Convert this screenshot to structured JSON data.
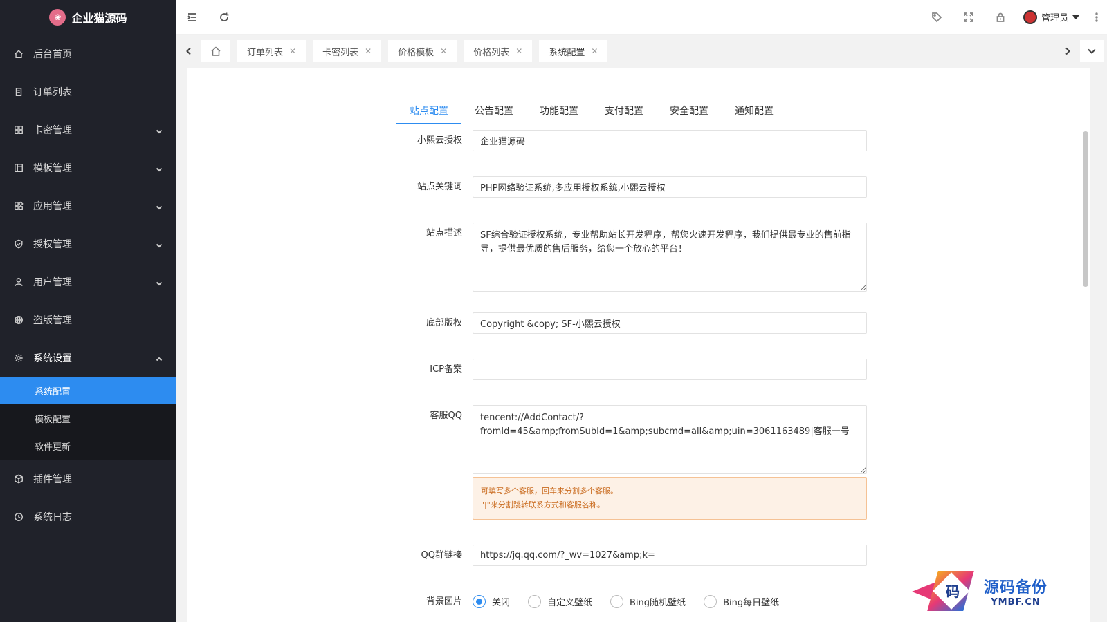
{
  "brand": {
    "name": "企业猫源码",
    "logo_icon": "lotus-logo-icon"
  },
  "sidebar": {
    "items": [
      {
        "label": "后台首页",
        "icon": "home-icon"
      },
      {
        "label": "订单列表",
        "icon": "document-icon"
      },
      {
        "label": "卡密管理",
        "icon": "grid-icon"
      },
      {
        "label": "模板管理",
        "icon": "template-icon"
      },
      {
        "label": "应用管理",
        "icon": "apps-icon"
      },
      {
        "label": "授权管理",
        "icon": "shield-icon"
      },
      {
        "label": "用户管理",
        "icon": "user-icon"
      },
      {
        "label": "盗版管理",
        "icon": "globe-icon"
      },
      {
        "label": "系统设置",
        "icon": "gear-icon"
      },
      {
        "label": "插件管理",
        "icon": "cube-icon"
      },
      {
        "label": "系统日志",
        "icon": "clock-icon"
      }
    ],
    "sub_items": [
      {
        "label": "系统配置"
      },
      {
        "label": "模板配置"
      },
      {
        "label": "软件更新"
      }
    ]
  },
  "header": {
    "user_name": "管理员"
  },
  "page_tabs": [
    {
      "label": "订单列表"
    },
    {
      "label": "卡密列表"
    },
    {
      "label": "价格模板"
    },
    {
      "label": "价格列表"
    },
    {
      "label": "系统配置"
    }
  ],
  "config_tabs": [
    "站点配置",
    "公告配置",
    "功能配置",
    "支付配置",
    "安全配置",
    "通知配置"
  ],
  "form": {
    "auth_label": "小熙云授权",
    "auth_value": "企业猫源码",
    "keywords_label": "站点关键词",
    "keywords_value": "PHP网络验证系统,多应用授权系统,小熙云授权",
    "desc_label": "站点描述",
    "desc_value": "SF综合验证授权系统，专业帮助站长开发程序，帮您火速开发程序，我们提供最专业的售前指导，提供最优质的售后服务，给您一个放心的平台！",
    "copyright_label": "底部版权",
    "copyright_value": "Copyright &copy; SF-小熙云授权",
    "icp_label": "ICP备案",
    "icp_value": "",
    "qq_label": "客服QQ",
    "qq_value": "tencent://AddContact/?fromId=45&amp;fromSubId=1&amp;subcmd=all&amp;uin=3061163489|客服一号",
    "qq_hint_1": "可填写多个客服，回车来分割多个客服。",
    "qq_hint_2": "\"|\"来分割跳转联系方式和客服名称。",
    "group_label": "QQ群链接",
    "group_value": "https://jq.qq.com/?_wv=1027&amp;k=",
    "bg_label": "背景图片",
    "bg_options": [
      "关闭",
      "自定义壁纸",
      "Bing随机壁纸",
      "Bing每日壁纸"
    ]
  },
  "watermark": {
    "cn": "源码备份",
    "en": "YMBF.CN",
    "glyph": "码"
  }
}
